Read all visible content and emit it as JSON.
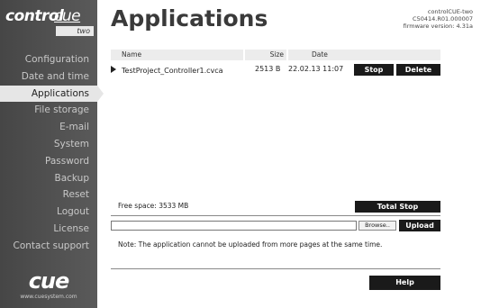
{
  "logo": {
    "part1": "control",
    "part2": "cue",
    "badge": "two"
  },
  "nav": [
    {
      "label": "Configuration",
      "active": false
    },
    {
      "label": "Date and time",
      "active": false
    },
    {
      "label": "Applications",
      "active": true
    },
    {
      "label": "File storage",
      "active": false
    },
    {
      "label": "E-mail",
      "active": false
    },
    {
      "label": "System",
      "active": false
    },
    {
      "label": "Password",
      "active": false
    },
    {
      "label": "Backup",
      "active": false
    },
    {
      "label": "Reset",
      "active": false
    },
    {
      "label": "Logout",
      "active": false
    },
    {
      "label": "License",
      "active": false
    },
    {
      "label": "Contact support",
      "active": false
    }
  ],
  "brand": {
    "name": "cue",
    "url": "www.cuesystem.com"
  },
  "header": {
    "title": "Applications",
    "device_name": "controlCUE-two",
    "serial": "C50414.R01.000007",
    "firmware": "firmware version: 4.31a"
  },
  "table": {
    "columns": {
      "name": "Name",
      "size": "Size",
      "date": "Date"
    },
    "rows": [
      {
        "name": "TestProject_Controller1.cvca",
        "size": "2513 B",
        "date": "22.02.13 11:07",
        "stop": "Stop",
        "delete": "Delete"
      }
    ]
  },
  "storage": {
    "free_space": "Free space: 3533 MB",
    "total_stop": "Total Stop"
  },
  "upload": {
    "browse": "Browse..",
    "upload": "Upload",
    "value": ""
  },
  "note": "Note: The application cannot be uploaded from more pages at the same time.",
  "help": "Help",
  "colors": {
    "sidebar": "#4e4e4e",
    "active": "#e6e6e6",
    "button": "#1a1a1a"
  }
}
